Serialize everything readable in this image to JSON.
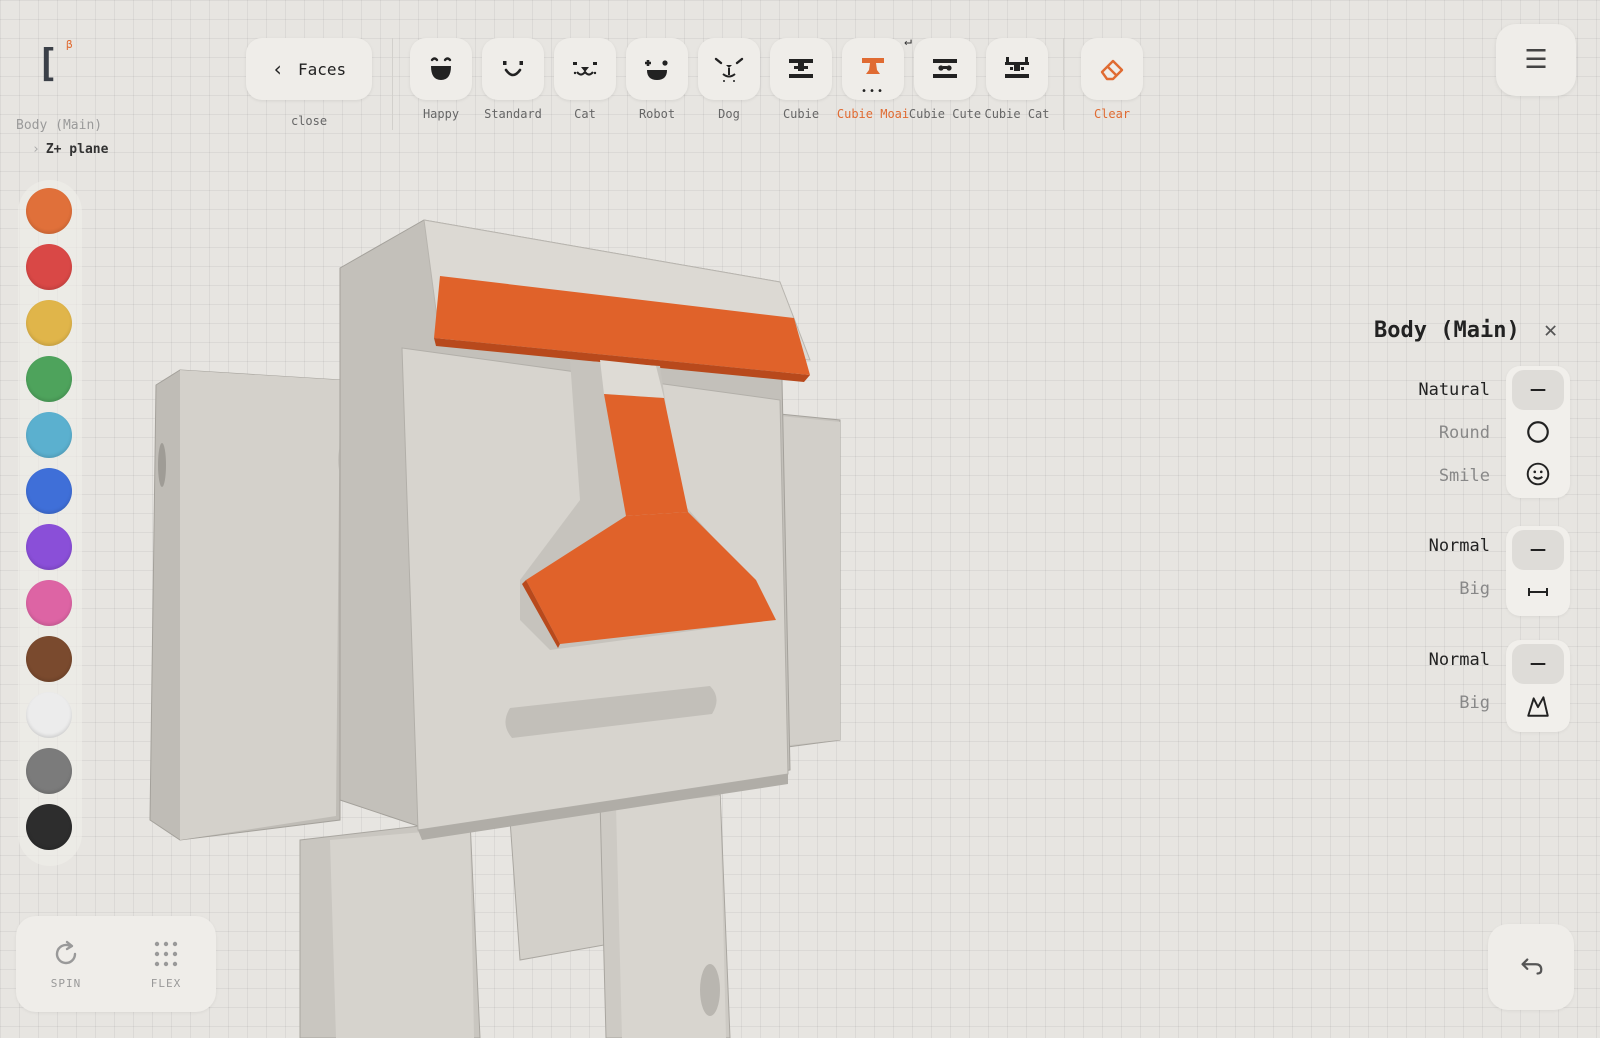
{
  "logo": {
    "mark": "[",
    "badge": "β"
  },
  "breadcrumb": {
    "root": "Body (Main)",
    "child": "Z+ plane",
    "child_icon": "chevron-right-icon"
  },
  "toolbar": {
    "faces_button": "Faces",
    "faces_icon": "chevron-left-icon",
    "close_label": "close",
    "faces": [
      {
        "label": "Happy",
        "icon": "happy-face-icon"
      },
      {
        "label": "Standard",
        "icon": "smile-face-icon"
      },
      {
        "label": "Cat",
        "icon": "cat-face-icon"
      },
      {
        "label": "Robot",
        "icon": "robot-face-icon"
      },
      {
        "label": "Dog",
        "icon": "dog-face-icon"
      },
      {
        "label": "Cubie",
        "icon": "cubie-face-icon"
      },
      {
        "label": "Cubie Moai",
        "icon": "moai-face-icon",
        "selected": true,
        "more": "•••"
      },
      {
        "label": "Cubie Cute",
        "icon": "cubie-cute-face-icon"
      },
      {
        "label": "Cubie Cat",
        "icon": "cubie-cat-face-icon"
      }
    ],
    "clear_label": "Clear",
    "clear_icon": "eraser-icon",
    "return_mark": "↵"
  },
  "menu": {
    "icon": "hamburger-menu-icon",
    "glyph": "☰"
  },
  "palette": {
    "colors": [
      "#e0703a",
      "#d94846",
      "#e0b54a",
      "#4ea35c",
      "#5bb0cf",
      "#3f6fd8",
      "#8a4fd8",
      "#dd64a4",
      "#7a4a2e",
      "#ececec",
      "#7b7b7b",
      "#2d2d2d"
    ]
  },
  "accent": "#e06b32",
  "model": {
    "body_color": "#cfccc6",
    "nose_color": "#e0622a"
  },
  "tools": {
    "spin": {
      "label": "SPIN",
      "icon": "rotate-icon"
    },
    "flex": {
      "label": "FLEX",
      "icon": "grid-dots-icon"
    }
  },
  "undo": {
    "icon": "undo-icon"
  },
  "panel": {
    "title": "Body (Main)",
    "close": "✕",
    "groups": [
      {
        "options": [
          {
            "label": "Natural",
            "icon": "dash-icon",
            "active": true
          },
          {
            "label": "Round",
            "icon": "circle-icon"
          },
          {
            "label": "Smile",
            "icon": "smiley-icon"
          }
        ]
      },
      {
        "options": [
          {
            "label": "Normal",
            "icon": "dash-icon",
            "active": true
          },
          {
            "label": "Big",
            "icon": "width-icon"
          }
        ]
      },
      {
        "options": [
          {
            "label": "Normal",
            "icon": "dash-icon",
            "active": true
          },
          {
            "label": "Big",
            "icon": "ear-icon"
          }
        ]
      }
    ]
  }
}
